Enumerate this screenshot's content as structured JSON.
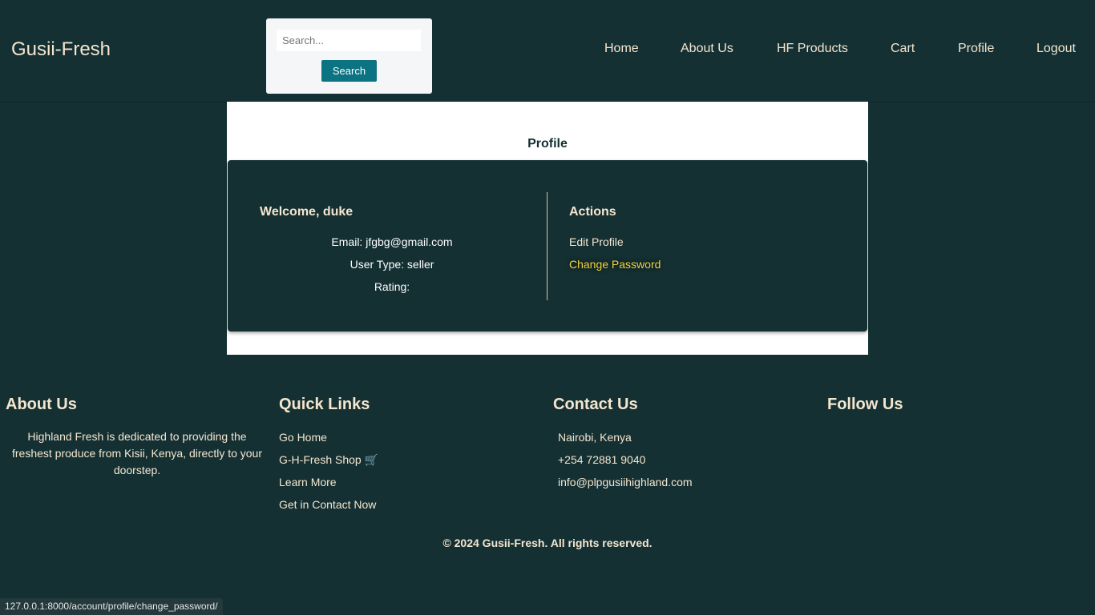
{
  "header": {
    "brand": "Gusii-Fresh",
    "search": {
      "placeholder": "Search...",
      "value": "",
      "button_label": "Search"
    },
    "nav": [
      "Home",
      "About Us",
      "HF Products",
      "Cart",
      "Profile",
      "Logout"
    ]
  },
  "profile": {
    "title": "Profile",
    "welcome": "Welcome, duke",
    "email": "Email: jfgbg@gmail.com",
    "user_type": "User Type: seller",
    "rating": "Rating:",
    "actions_title": "Actions",
    "actions": [
      "Edit Profile",
      "Change Password"
    ]
  },
  "footer": {
    "about": {
      "heading": "About Us",
      "text": "Highland Fresh is dedicated to providing the freshest produce from Kisii, Kenya, directly to your doorstep."
    },
    "quick_links": {
      "heading": "Quick Links",
      "links": [
        "Go Home",
        "G-H-Fresh Shop 🛒",
        "Learn More",
        "Get in Contact Now"
      ]
    },
    "contact": {
      "heading": "Contact Us",
      "location": "Nairobi, Kenya",
      "phone": "+254 72881 9040",
      "email": "info@plpgusiihighland.com"
    },
    "follow": {
      "heading": "Follow Us"
    },
    "copyright": "© 2024 Gusii-Fresh. All rights reserved."
  },
  "status_bar": {
    "url": "127.0.0.1:8000/account/profile/change_password/"
  },
  "colors": {
    "background": "#143033",
    "accent_text": "#f5e6cf",
    "search_button": "#0c7382",
    "hover_link": "#f2d43a"
  }
}
